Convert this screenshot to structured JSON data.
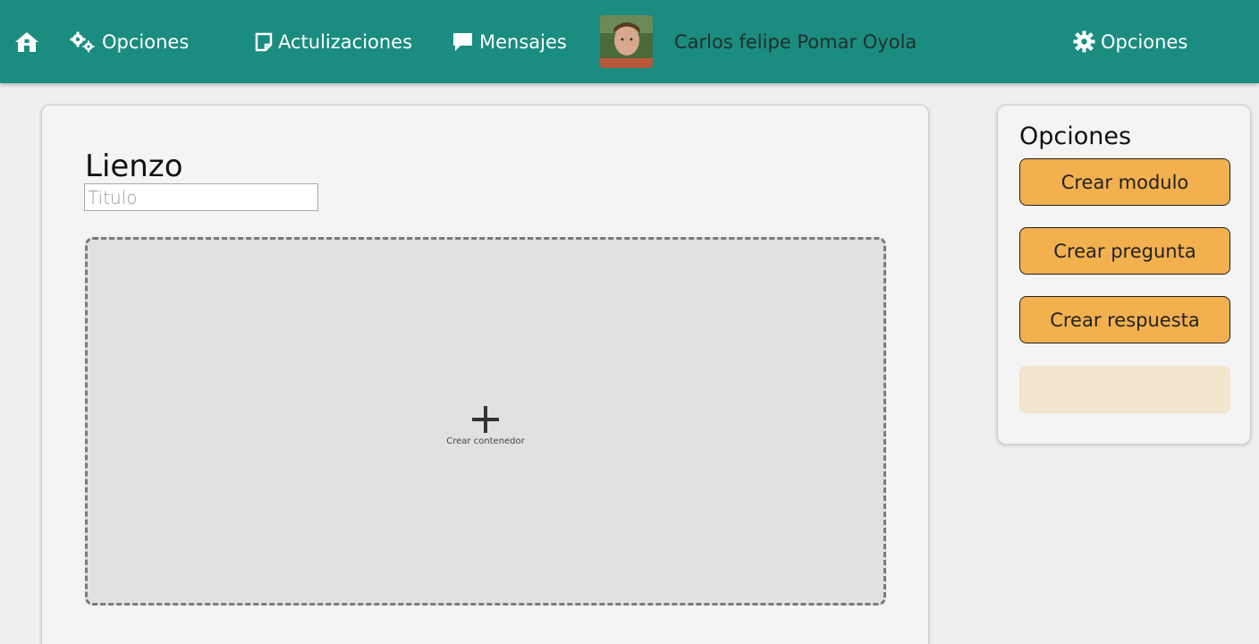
{
  "navbar": {
    "home_icon": "home-icon",
    "opciones_left": {
      "icon": "gears-icon",
      "label": "Opciones"
    },
    "actualizaciones": {
      "icon": "note-icon",
      "label": "Actulizaciones"
    },
    "mensajes": {
      "icon": "comment-icon",
      "label": "Mensajes"
    },
    "user": {
      "name": "Carlos felipe Pomar Oyola"
    },
    "opciones_right": {
      "icon": "gear-icon",
      "label": "Opciones"
    },
    "bg_color": "#1b8c80"
  },
  "canvas": {
    "title": "Lienzo",
    "title_input": {
      "placeholder": "Titulo",
      "value": ""
    },
    "dropzone": {
      "icon": "plus-icon",
      "label": "Crear contenedor"
    }
  },
  "options_panel": {
    "title": "Opciones",
    "buttons": [
      {
        "label": "Crear modulo",
        "state": "enabled"
      },
      {
        "label": "Crear pregunta",
        "state": "enabled"
      },
      {
        "label": "Crear respuesta",
        "state": "enabled"
      },
      {
        "label": "",
        "state": "disabled"
      }
    ],
    "accent_color": "#f2b04f"
  }
}
